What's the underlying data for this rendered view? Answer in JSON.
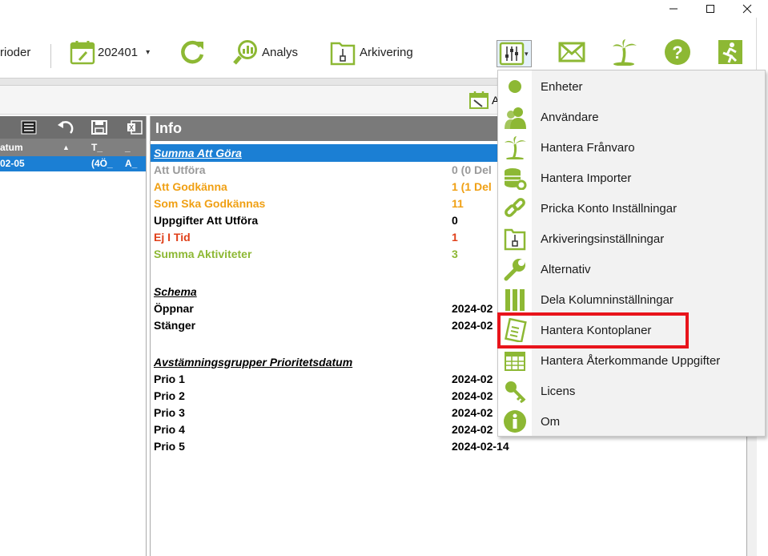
{
  "window": {
    "minimize": "—",
    "maximize": "☐",
    "close": "✕"
  },
  "toolbar": {
    "perioder_label": "rioder",
    "period_label": "202401",
    "period_arrow": "▾",
    "analys_label": "Analys",
    "arkivering_label": "Arkivering",
    "settings_arrow": "▾"
  },
  "secondbar": {
    "button_label": "A"
  },
  "leftpanel": {
    "headers": [
      "atum",
      "T_",
      "_"
    ],
    "row": [
      "02-05",
      "(4Ö_",
      "A_"
    ]
  },
  "info": {
    "title": "Info",
    "summa_header": "Summa Att Göra",
    "rows": [
      {
        "label": "Att Utföra",
        "value": "0 (0 Del",
        "color": "#9a9a9a"
      },
      {
        "label": "Att Godkänna",
        "value": "1 (1 Del",
        "color": "#f0a014"
      },
      {
        "label": "Som Ska Godkännas",
        "value": "11",
        "color": "#f0a014"
      },
      {
        "label": "Uppgifter Att Utföra",
        "value": "0",
        "color": "#000000"
      },
      {
        "label": "Ej I Tid",
        "value": "1",
        "color": "#e0401a"
      },
      {
        "label": "Summa Aktiviteter",
        "value": "3",
        "color": "#8db834"
      }
    ],
    "schema_header": "Schema",
    "schema": [
      {
        "label": "Öppnar",
        "value": "2024-02"
      },
      {
        "label": "Stänger",
        "value": "2024-02"
      }
    ],
    "prio_header": "Avstämningsgrupper Prioritetsdatum",
    "prio": [
      {
        "label": "Prio 1",
        "value": "2024-02"
      },
      {
        "label": "Prio 2",
        "value": "2024-02"
      },
      {
        "label": "Prio 3",
        "value": "2024-02"
      },
      {
        "label": "Prio 4",
        "value": "2024-02"
      },
      {
        "label": "Prio 5",
        "value": "2024-02-14"
      }
    ]
  },
  "menu": {
    "items": [
      {
        "label": "Enheter",
        "icon": "circle-icon"
      },
      {
        "label": "Användare",
        "icon": "users-icon"
      },
      {
        "label": "Hantera Frånvaro",
        "icon": "palm-tree-icon"
      },
      {
        "label": "Hantera Importer",
        "icon": "database-gear-icon"
      },
      {
        "label": "Pricka Konto Inställningar",
        "icon": "chain-link-icon"
      },
      {
        "label": "Arkiveringsinställningar",
        "icon": "archive-folder-icon"
      },
      {
        "label": "Alternativ",
        "icon": "wrench-icon"
      },
      {
        "label": "Dela Kolumninställningar",
        "icon": "columns-icon"
      },
      {
        "label": "Hantera Kontoplaner",
        "icon": "document-list-icon"
      },
      {
        "label": "Hantera Återkommande Uppgifter",
        "icon": "calendar-grid-icon"
      },
      {
        "label": "Licens",
        "icon": "key-icon"
      },
      {
        "label": "Om",
        "icon": "info-icon"
      }
    ]
  },
  "colors": {
    "accent": "#8db834",
    "selection": "#1b7fd4",
    "highlight": "#e8141b"
  }
}
